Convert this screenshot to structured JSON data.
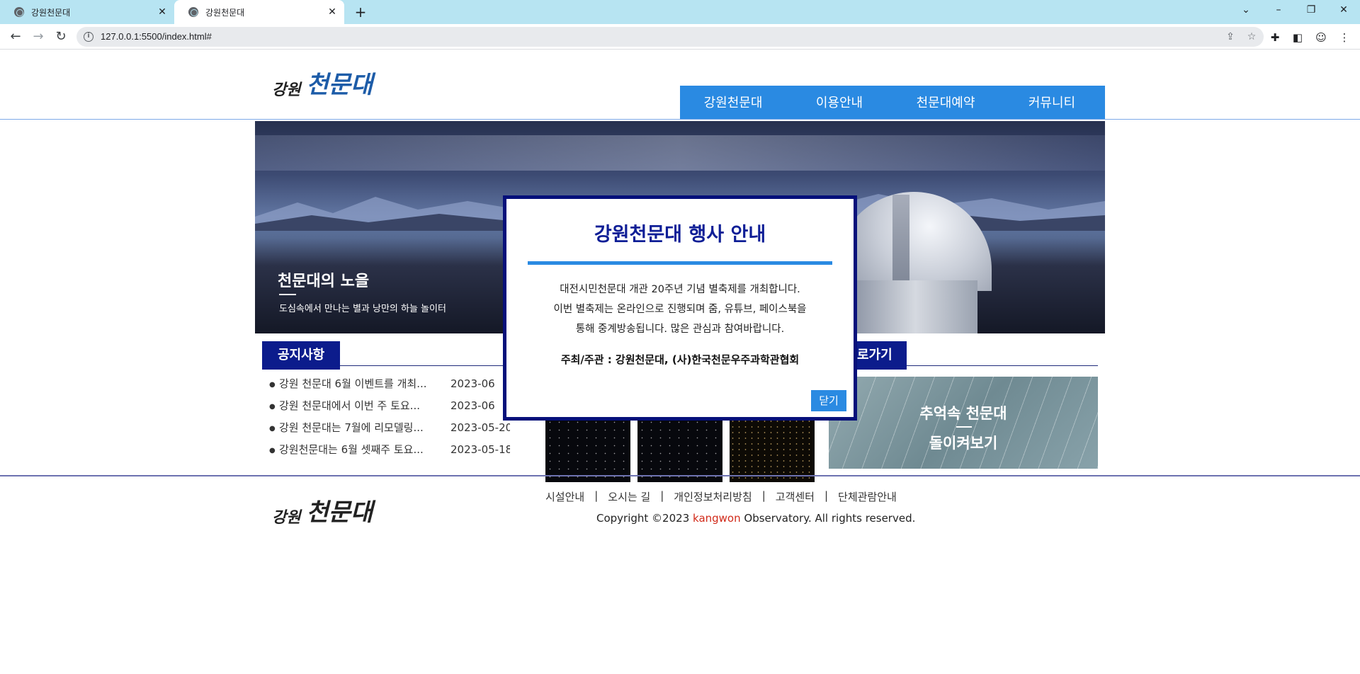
{
  "browser": {
    "tabs": [
      {
        "label": "강원천문대"
      },
      {
        "label": "강원천문대"
      }
    ],
    "url": "127.0.0.1:5500/index.html#"
  },
  "header": {
    "logo_small": "강원",
    "logo_big": "천문대",
    "nav": [
      "강원천문대",
      "이용안내",
      "천문대예약",
      "커뮤니티"
    ]
  },
  "banner": {
    "title": "천문대의 노을",
    "subtitle": "도심속에서 만나는 별과 낭만의 하늘 놀이터"
  },
  "notice": {
    "heading": "공지사항",
    "items": [
      {
        "title": "강원 천문대 6월 이벤트를 개최...",
        "date": "2023-06"
      },
      {
        "title": "강원 천문대에서 이번 주 토요...",
        "date": "2023-06"
      },
      {
        "title": "강원 천문대는 7월에 리모델링...",
        "date": "2023-05-20"
      },
      {
        "title": "강원천문대는 6월 셋째주 토요...",
        "date": "2023-05-18"
      }
    ]
  },
  "shortcut": {
    "heading": "로가기",
    "memory_line1": "추억속 천문대",
    "memory_line2": "돌이켜보기"
  },
  "footer": {
    "logo_small": "강원",
    "logo_big": "천문대",
    "links": [
      "시설안내",
      "오시는 길",
      "개인정보처리방침",
      "고객센터",
      "단체관람안내"
    ],
    "separator": "|",
    "copyright_prefix": "Copyright ©2023 ",
    "copyright_accent": "kangwon",
    "copyright_suffix": " Observatory. All rights reserved."
  },
  "modal": {
    "title": "강원천문대 행사 안내",
    "body_line1": "대전시민천문대 개관 20주년 기념 별축제를 개최합니다.",
    "body_line2": "이번 별축제는 온라인으로 진행되며 줌, 유튜브, 페이스북을",
    "body_line3": "통해 중계방송됩니다. 많은 관심과 참여바랍니다.",
    "host": "주최/주관 : 강원천문대, (사)한국천문우주과학관협회",
    "close_label": "닫기"
  },
  "colors": {
    "nav_bg": "#2a8ae2",
    "section_tab_bg": "#0c1c8c",
    "modal_border": "#06107a",
    "accent_red": "#d12a1a"
  }
}
